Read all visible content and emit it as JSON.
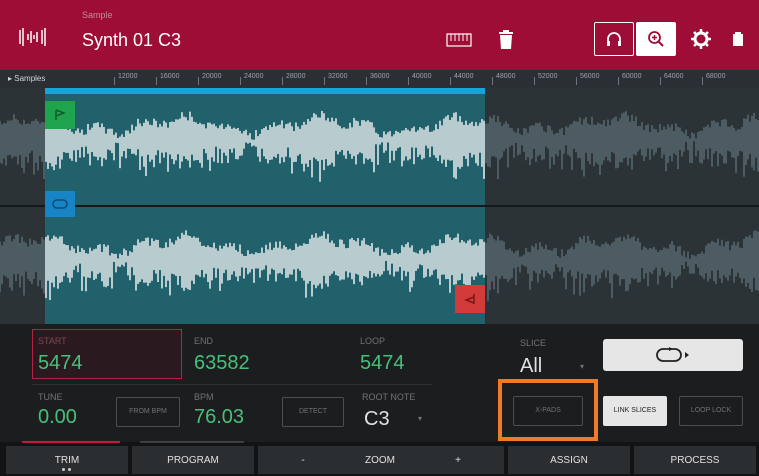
{
  "header": {
    "sample_label": "Sample",
    "sample_name": "Synth 01 C3"
  },
  "ruler": {
    "title": "Samples",
    "ticks": [
      "12000",
      "16000",
      "20000",
      "24000",
      "28000",
      "32000",
      "36000",
      "40000",
      "44000",
      "48000",
      "52000",
      "56000",
      "60000",
      "64000",
      "68000"
    ]
  },
  "params": {
    "start_label": "Start",
    "start_value": "5474",
    "end_label": "End",
    "end_value": "63582",
    "loop_label": "Loop",
    "loop_value": "5474",
    "slice_label": "Slice",
    "slice_value": "All",
    "tune_label": "Tune",
    "tune_value": "0.00",
    "from_bpm_label": "From BPM",
    "bpm_label": "BPM",
    "bpm_value": "76.03",
    "detect_label": "Detect",
    "root_note_label": "Root Note",
    "root_note_value": "C3",
    "xpads_label": "X-Pads",
    "link_slices_label": "Link Slices",
    "loop_lock_label": "Loop Lock"
  },
  "tabs": {
    "trim": "TRIM",
    "program": "PROGRAM",
    "zoom_minus": "-",
    "zoom": "ZOOM",
    "zoom_plus": "+",
    "assign": "ASSIGN",
    "process": "PROCESS"
  },
  "colors": {
    "header": "#9e0d35",
    "value_green": "#48c07a",
    "selection_blue": "#19a3d9",
    "highlight_orange": "#f07a25"
  }
}
